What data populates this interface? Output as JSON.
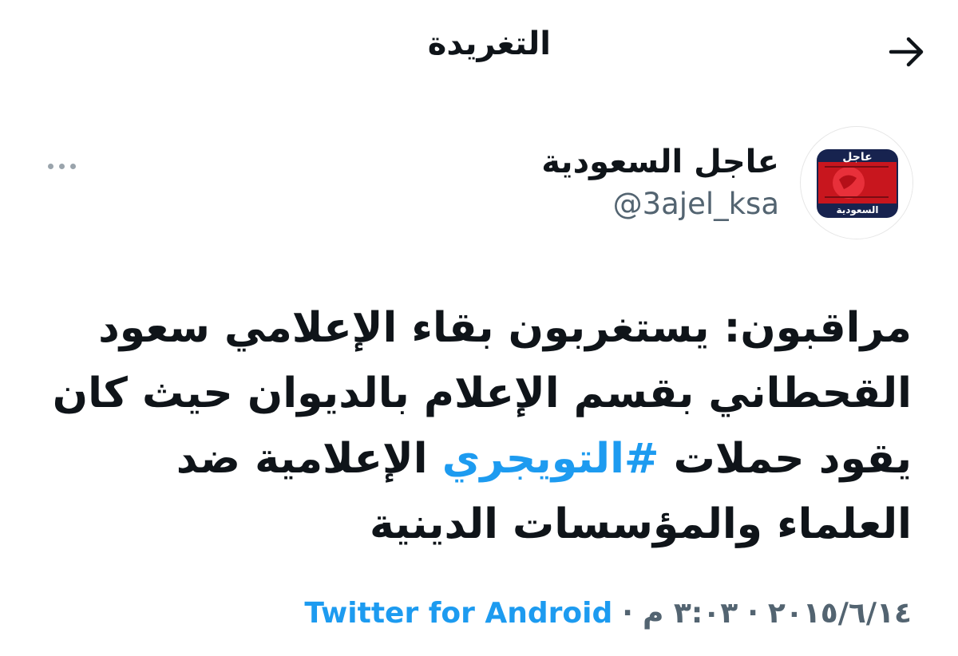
{
  "header": {
    "title": "التغريدة",
    "back_icon": "arrow-back-icon"
  },
  "author": {
    "display_name": "عاجل السعودية",
    "handle": "@3ajel_ksa",
    "avatar_top_text": "عاجل",
    "avatar_bottom_text": "السعودية",
    "more_icon": "more-options-icon"
  },
  "tweet": {
    "text_before": "مراقبون: يستغربون بقاء الإعلامي سعود القحطاني بقسم الإعلام بالديوان حيث كان يقود حملات",
    "hashtag": "#التويجري",
    "text_after": "الإعلامية ضد العلماء والمؤسسات الدينية"
  },
  "meta": {
    "date": "٢٠١٥/٦/١٤",
    "separator1": "·",
    "time": "٣:٠٣ م",
    "separator2": "·",
    "source": "Twitter for Android"
  },
  "colors": {
    "accent": "#1d9bf0",
    "text": "#0f1419",
    "muted": "#536471"
  }
}
